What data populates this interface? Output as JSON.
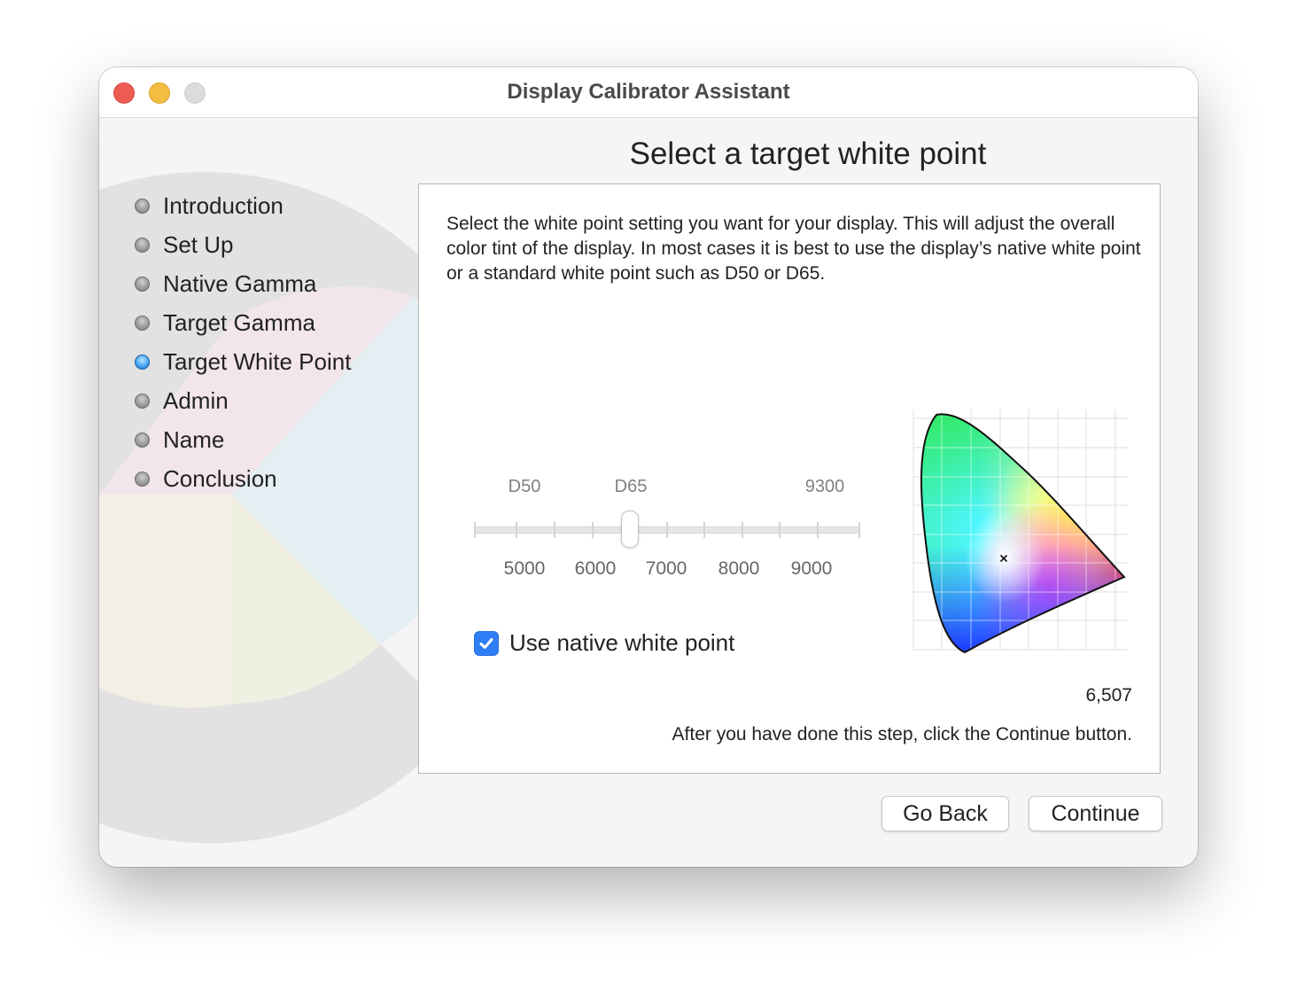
{
  "window": {
    "title": "Display Calibrator Assistant",
    "controls": [
      "close",
      "minimize",
      "zoom"
    ]
  },
  "page": {
    "heading": "Select a target white point"
  },
  "sidebar": {
    "items": [
      {
        "label": "Introduction",
        "active": false
      },
      {
        "label": "Set Up",
        "active": false
      },
      {
        "label": "Native Gamma",
        "active": false
      },
      {
        "label": "Target Gamma",
        "active": false
      },
      {
        "label": "Target White Point",
        "active": true
      },
      {
        "label": "Admin",
        "active": false
      },
      {
        "label": "Name",
        "active": false
      },
      {
        "label": "Conclusion",
        "active": false
      }
    ]
  },
  "content": {
    "description": "Select the white point setting you want for your display.  This will adjust the overall color tint of the display.  In most cases it is best to use the display’s native white point or a standard white point such as D50 or D65.",
    "slider": {
      "presets": {
        "d50": "D50",
        "d65": "D65",
        "p9300": "9300"
      },
      "scale": {
        "k5000": "5000",
        "k6000": "6000",
        "k7000": "7000",
        "k8000": "8000",
        "k9000": "9000"
      },
      "value_kelvin": 6507,
      "disabled": true
    },
    "native_checkbox": {
      "label": "Use native white point",
      "checked": true
    },
    "temperature_readout": "6,507",
    "footer": "After you have done this step, click the Continue button."
  },
  "buttons": {
    "back": "Go Back",
    "continue": "Continue"
  },
  "colors": {
    "active_step": "#4aa6f1",
    "checkbox": "#2f7ef6",
    "close": "#ee5b52",
    "minimize": "#f4bc40"
  }
}
